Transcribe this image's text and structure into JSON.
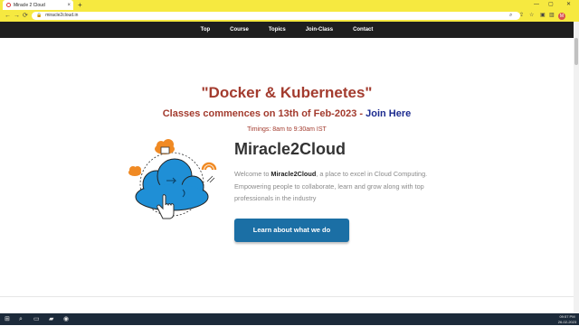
{
  "browser": {
    "tab_title": "Miracle 2 Cloud",
    "tab_close": "×",
    "new_tab": "+",
    "url": "miracle2cloud.in",
    "window_controls": [
      "—",
      "▢",
      "✕"
    ]
  },
  "nav": {
    "items": [
      "Top",
      "Course",
      "Topics",
      "Join-Class",
      "Contact"
    ]
  },
  "hero": {
    "title": "\"Docker & Kubernetes\"",
    "subtitle": "Classes commences on 13th of Feb-2023 - ",
    "join_link": "Join Here",
    "timings": "Timings: 8am to 9:30am IST",
    "brand": "Miracle2Cloud",
    "desc_prefix": "Welcome to ",
    "desc_brand": "Miracle2Cloud",
    "desc_rest": ", a place to excel in Cloud Computing. Empowering people to collaborate, learn and grow along with top professionals in the industry",
    "cta": "Learn about what we do"
  },
  "profile_initial": "M",
  "taskbar": {
    "time": "09:57 PM",
    "date": "26-02-2023"
  },
  "colors": {
    "accent_red": "#a33b2e",
    "link_blue": "#1c2b8f",
    "cta_blue": "#1b6fa5",
    "cloud_blue": "#1f8fd6",
    "icon_orange": "#f08a24",
    "chrome_yellow": "#f6e940"
  }
}
